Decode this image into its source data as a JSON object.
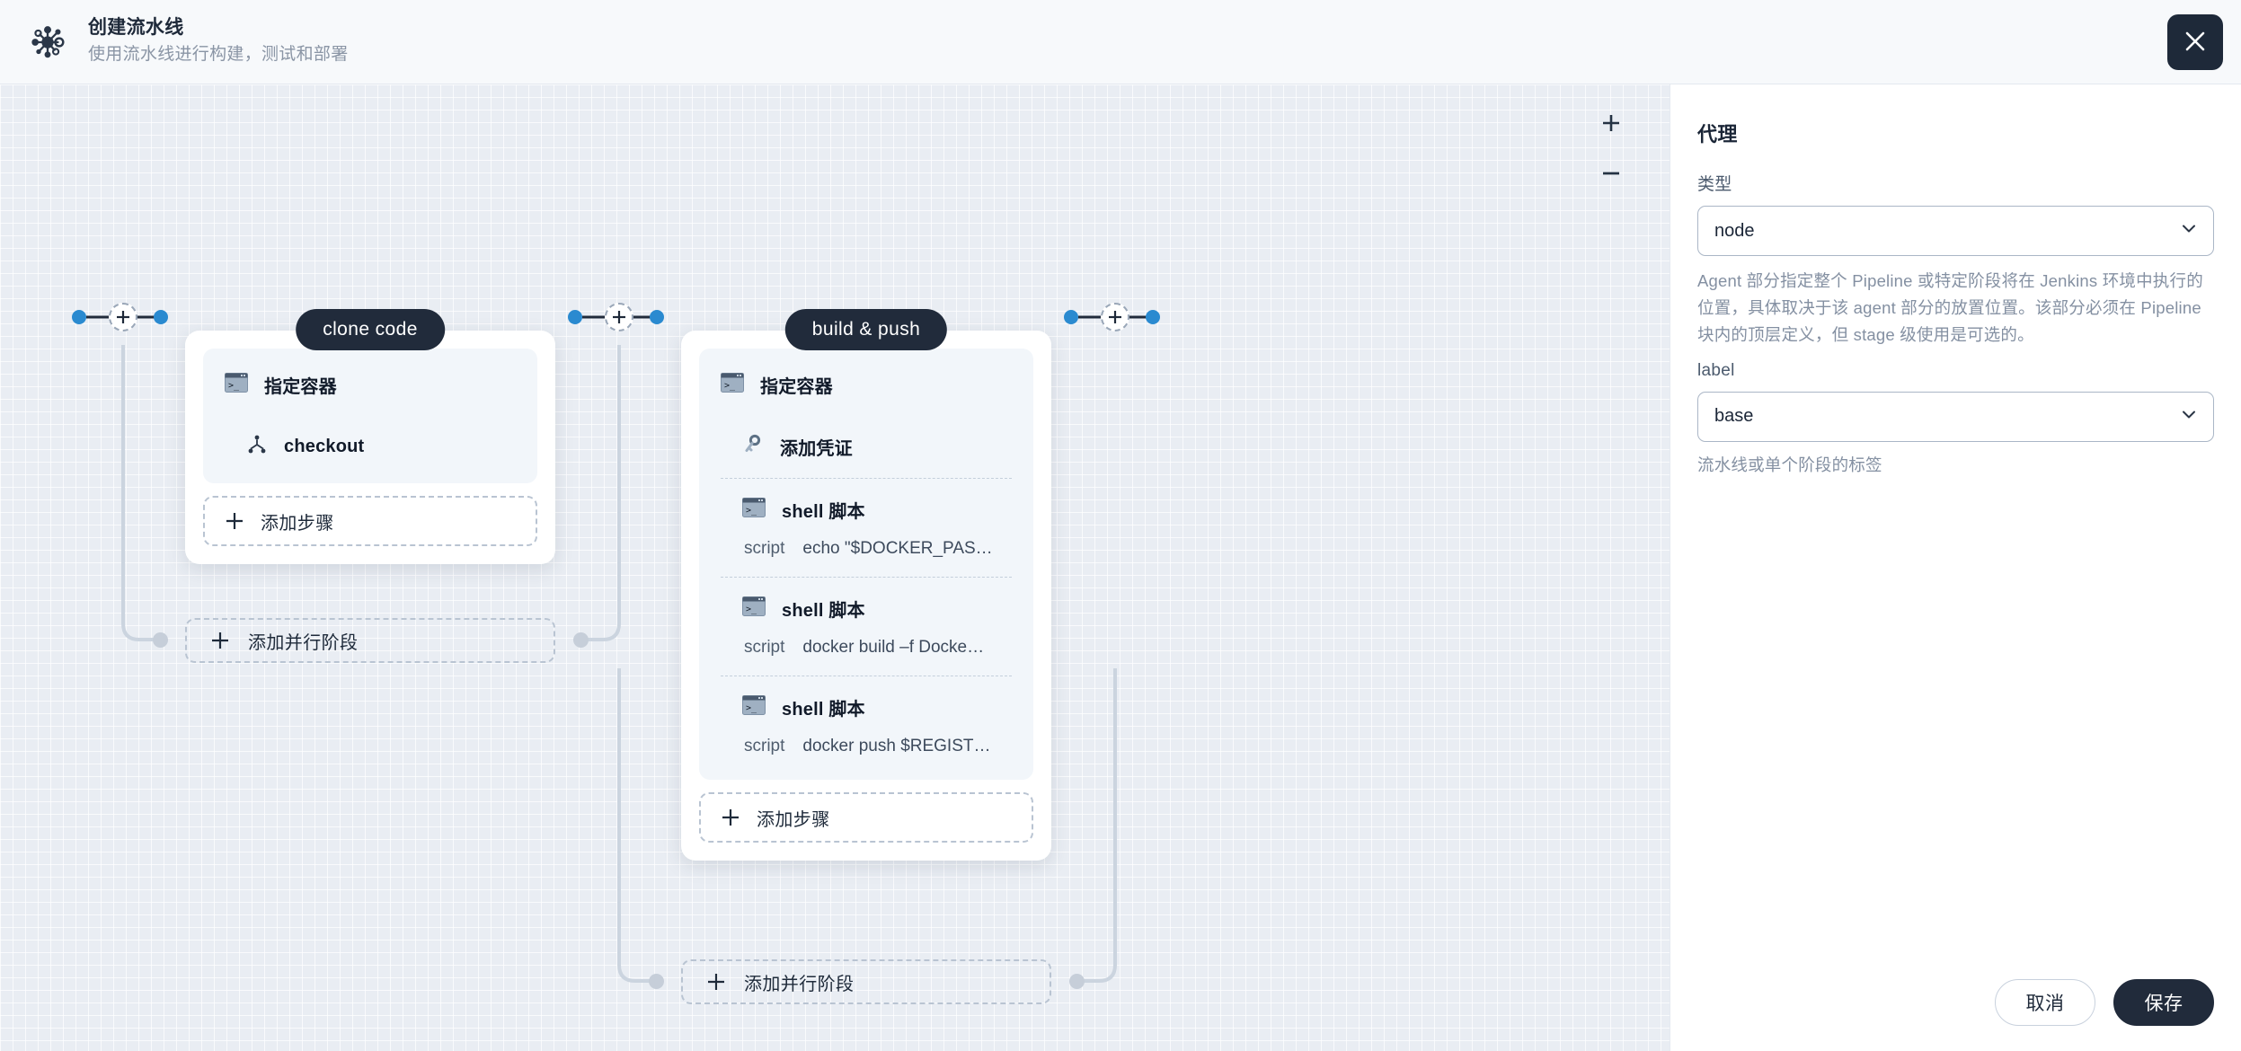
{
  "header": {
    "logo_icon": "pipeline-hub-icon",
    "title": "创建流水线",
    "subtitle": "使用流水线进行构建，测试和部署",
    "close_icon": "close-icon"
  },
  "canvas": {
    "zoom_in_label": "+",
    "zoom_out_label": "−",
    "add_step_label": "添加步骤",
    "add_parallel_label": "添加并行阶段",
    "stages": [
      {
        "name": "clone code",
        "steps": [
          {
            "icon": "terminal-icon",
            "title": "指定容器",
            "indent": false
          },
          {
            "icon": "git-branch-icon",
            "title": "checkout",
            "indent": true
          }
        ]
      },
      {
        "name": "build & push",
        "steps": [
          {
            "icon": "terminal-icon",
            "title": "指定容器",
            "indent": false
          },
          {
            "icon": "key-icon",
            "title": "添加凭证",
            "indent": true
          },
          {
            "icon": "terminal-icon",
            "title": "shell 脚本",
            "indent": true,
            "key": "script",
            "value": "echo \"$DOCKER_PAS…"
          },
          {
            "icon": "terminal-icon",
            "title": "shell 脚本",
            "indent": true,
            "key": "script",
            "value": "docker build –f Docke…"
          },
          {
            "icon": "terminal-icon",
            "title": "shell 脚本",
            "indent": true,
            "key": "script",
            "value": "docker push $REGIST…"
          }
        ]
      }
    ]
  },
  "panel": {
    "title": "代理",
    "type_label": "类型",
    "type_value": "node",
    "type_help": "Agent 部分指定整个 Pipeline 或特定阶段将在 Jenkins 环境中执行的位置，具体取决于该 agent 部分的放置位置。该部分必须在 Pipeline 块内的顶层定义，但 stage 级使用是可选的。",
    "label_label": "label",
    "label_value": "base",
    "label_hint": "流水线或单个阶段的标签",
    "chevron_icon": "chevron-down-icon",
    "cancel_label": "取消",
    "save_label": "保存"
  },
  "colors": {
    "accent_blue": "#2a8ad0",
    "dark": "#212b3b",
    "canvas_bg": "#e9edf3",
    "muted": "#8490a2"
  }
}
